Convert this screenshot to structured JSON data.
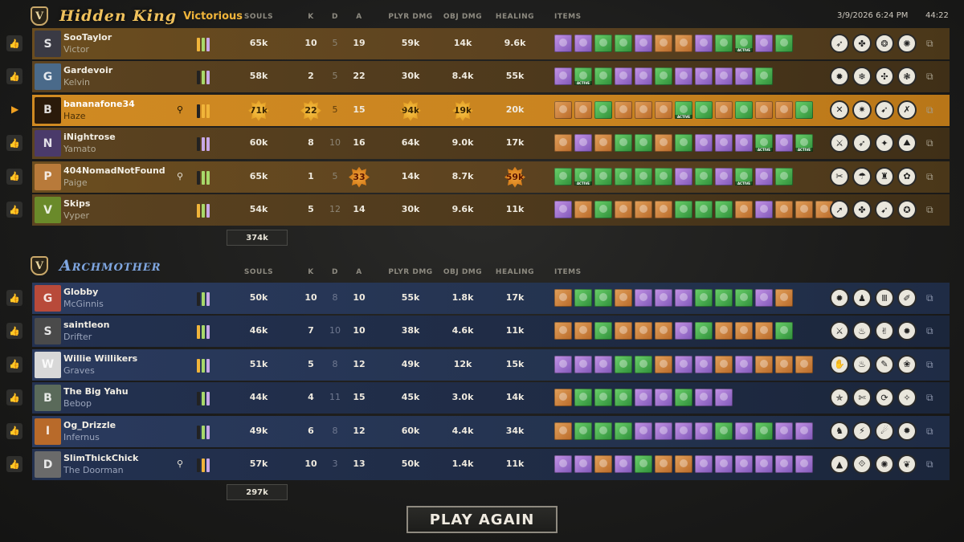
{
  "meta": {
    "datetime": "3/9/2026 6:24 PM",
    "duration": "44:22"
  },
  "headers": {
    "souls": "SOULS",
    "k": "K",
    "d": "D",
    "a": "A",
    "player_damage": "PLYR DMG",
    "objective_damage": "OBJ DMG",
    "healing": "HEALING",
    "items": "ITEMS"
  },
  "team1": {
    "badge": "V",
    "name": "Hidden King",
    "result": "Victorious",
    "total_souls": "374k",
    "players": [
      {
        "name": "SooTaylor",
        "hero": "Victor",
        "souls": "65k",
        "k": "10",
        "d": "5",
        "a": "19",
        "player_damage": "59k",
        "objective_damage": "14k",
        "healing": "9.6k",
        "initial": "S",
        "color": "#3a3a44",
        "bars": [
          "y",
          "g",
          "p"
        ],
        "flag": false,
        "highlights": [],
        "items": [
          {
            "c": "p"
          },
          {
            "c": "p"
          },
          {
            "c": "g"
          },
          {
            "c": "g"
          },
          {
            "c": "p"
          },
          {
            "c": "o"
          },
          {
            "c": "o"
          },
          {
            "c": "p"
          },
          {
            "c": "g"
          },
          {
            "c": "g",
            "active": true
          },
          {
            "c": "p"
          },
          {
            "c": "g"
          }
        ],
        "abilities": [
          "➶",
          "✤",
          "❂",
          "✺"
        ]
      },
      {
        "name": "Gardevoir",
        "hero": "Kelvin",
        "souls": "58k",
        "k": "2",
        "d": "5",
        "a": "22",
        "player_damage": "30k",
        "objective_damage": "8.4k",
        "healing": "55k",
        "initial": "G",
        "color": "#4a6a8a",
        "bars": [
          "d",
          "g",
          "p"
        ],
        "flag": false,
        "highlights": [],
        "items": [
          {
            "c": "p"
          },
          {
            "c": "g",
            "active": true
          },
          {
            "c": "g"
          },
          {
            "c": "p"
          },
          {
            "c": "p"
          },
          {
            "c": "g"
          },
          {
            "c": "p"
          },
          {
            "c": "p"
          },
          {
            "c": "p"
          },
          {
            "c": "p"
          },
          {
            "c": "g"
          }
        ],
        "abilities": [
          "✹",
          "❄",
          "✣",
          "❃"
        ]
      },
      {
        "name": "bananafone34",
        "hero": "Haze",
        "souls": "71k",
        "k": "22",
        "d": "5",
        "a": "15",
        "player_damage": "94k",
        "objective_damage": "19k",
        "healing": "20k",
        "initial": "B",
        "color": "#2a1a0a",
        "bars": [
          "d",
          "y",
          "y"
        ],
        "flag": true,
        "self": true,
        "highlights": [
          "souls",
          "k",
          "player_damage",
          "objective_damage"
        ],
        "items": [
          {
            "c": "o"
          },
          {
            "c": "o"
          },
          {
            "c": "g"
          },
          {
            "c": "o"
          },
          {
            "c": "o"
          },
          {
            "c": "o"
          },
          {
            "c": "g",
            "active": true
          },
          {
            "c": "g"
          },
          {
            "c": "o"
          },
          {
            "c": "g"
          },
          {
            "c": "o"
          },
          {
            "c": "o"
          },
          {
            "c": "g"
          }
        ],
        "abilities": [
          "✕",
          "✷",
          "➹",
          "✗"
        ]
      },
      {
        "name": "iNightrose",
        "hero": "Yamato",
        "souls": "60k",
        "k": "8",
        "d": "10",
        "a": "16",
        "player_damage": "64k",
        "objective_damage": "9.0k",
        "healing": "17k",
        "initial": "N",
        "color": "#4a3a6a",
        "bars": [
          "d",
          "p",
          "p"
        ],
        "flag": false,
        "highlights": [],
        "items": [
          {
            "c": "o"
          },
          {
            "c": "p"
          },
          {
            "c": "o"
          },
          {
            "c": "g"
          },
          {
            "c": "g"
          },
          {
            "c": "o"
          },
          {
            "c": "g"
          },
          {
            "c": "p"
          },
          {
            "c": "p"
          },
          {
            "c": "p"
          },
          {
            "c": "g",
            "active": true
          },
          {
            "c": "p"
          },
          {
            "c": "g",
            "active": true
          }
        ],
        "abilities": [
          "⚔",
          "➶",
          "✦",
          "⛰"
        ]
      },
      {
        "name": "404NomadNotFound",
        "hero": "Paige",
        "souls": "65k",
        "k": "1",
        "d": "5",
        "a": "33",
        "player_damage": "14k",
        "objective_damage": "8.7k",
        "healing": "59k",
        "initial": "P",
        "color": "#b87a3a",
        "bars": [
          "d",
          "g",
          "g"
        ],
        "flag": true,
        "highlights": [
          "a",
          "healing"
        ],
        "items": [
          {
            "c": "g"
          },
          {
            "c": "g",
            "active": true
          },
          {
            "c": "g"
          },
          {
            "c": "g"
          },
          {
            "c": "g"
          },
          {
            "c": "g"
          },
          {
            "c": "p"
          },
          {
            "c": "g"
          },
          {
            "c": "p"
          },
          {
            "c": "g",
            "active": true
          },
          {
            "c": "p"
          },
          {
            "c": "g"
          }
        ],
        "abilities": [
          "✂",
          "☂",
          "♜",
          "✿"
        ]
      },
      {
        "name": "Skips",
        "hero": "Vyper",
        "souls": "54k",
        "k": "5",
        "d": "12",
        "a": "14",
        "player_damage": "30k",
        "objective_damage": "9.6k",
        "healing": "11k",
        "initial": "V",
        "color": "#6a8a2a",
        "bars": [
          "y",
          "g",
          "p"
        ],
        "flag": false,
        "highlights": [],
        "items": [
          {
            "c": "p"
          },
          {
            "c": "o"
          },
          {
            "c": "g"
          },
          {
            "c": "o"
          },
          {
            "c": "o"
          },
          {
            "c": "o"
          },
          {
            "c": "g"
          },
          {
            "c": "g"
          },
          {
            "c": "g"
          },
          {
            "c": "o"
          },
          {
            "c": "p"
          },
          {
            "c": "o"
          },
          {
            "c": "o"
          },
          {
            "c": "o"
          }
        ],
        "abilities": [
          "➚",
          "✤",
          "➹",
          "✪"
        ]
      }
    ]
  },
  "team2": {
    "badge": "V",
    "name": "Archmother",
    "total_souls": "297k",
    "players": [
      {
        "name": "Globby",
        "hero": "McGinnis",
        "souls": "50k",
        "k": "10",
        "d": "8",
        "a": "10",
        "player_damage": "55k",
        "objective_damage": "1.8k",
        "healing": "17k",
        "initial": "G",
        "color": "#b84a3a",
        "bars": [
          "d",
          "g",
          "p"
        ],
        "flag": false,
        "highlights": [],
        "items": [
          {
            "c": "o"
          },
          {
            "c": "g"
          },
          {
            "c": "g"
          },
          {
            "c": "o"
          },
          {
            "c": "p"
          },
          {
            "c": "p"
          },
          {
            "c": "p"
          },
          {
            "c": "g"
          },
          {
            "c": "g"
          },
          {
            "c": "g"
          },
          {
            "c": "p"
          },
          {
            "c": "o"
          }
        ],
        "abilities": [
          "✹",
          "♟",
          "Ⅲ",
          "✐"
        ]
      },
      {
        "name": "saintleon",
        "hero": "Drifter",
        "souls": "46k",
        "k": "7",
        "d": "10",
        "a": "10",
        "player_damage": "38k",
        "objective_damage": "4.6k",
        "healing": "11k",
        "initial": "S",
        "color": "#4a4a4a",
        "bars": [
          "y",
          "g",
          "p"
        ],
        "flag": false,
        "highlights": [],
        "items": [
          {
            "c": "o"
          },
          {
            "c": "o"
          },
          {
            "c": "g"
          },
          {
            "c": "o"
          },
          {
            "c": "o"
          },
          {
            "c": "o"
          },
          {
            "c": "p"
          },
          {
            "c": "g"
          },
          {
            "c": "o"
          },
          {
            "c": "o"
          },
          {
            "c": "o"
          },
          {
            "c": "g"
          }
        ],
        "abilities": [
          "⚔",
          "♨",
          "✌",
          "✹"
        ]
      },
      {
        "name": "Willie Willikers",
        "hero": "Graves",
        "souls": "51k",
        "k": "5",
        "d": "8",
        "a": "12",
        "player_damage": "49k",
        "objective_damage": "12k",
        "healing": "15k",
        "initial": "W",
        "color": "#d8d8d8",
        "bars": [
          "y",
          "g",
          "p"
        ],
        "flag": false,
        "highlights": [],
        "items": [
          {
            "c": "p"
          },
          {
            "c": "p"
          },
          {
            "c": "p"
          },
          {
            "c": "g"
          },
          {
            "c": "g"
          },
          {
            "c": "o"
          },
          {
            "c": "p"
          },
          {
            "c": "p"
          },
          {
            "c": "o"
          },
          {
            "c": "p"
          },
          {
            "c": "o"
          },
          {
            "c": "o"
          },
          {
            "c": "o"
          }
        ],
        "abilities": [
          "✋",
          "♨",
          "✎",
          "❀"
        ]
      },
      {
        "name": "The Big Yahu",
        "hero": "Bebop",
        "souls": "44k",
        "k": "4",
        "d": "11",
        "a": "15",
        "player_damage": "45k",
        "objective_damage": "3.0k",
        "healing": "14k",
        "initial": "B",
        "color": "#5a6a5a",
        "bars": [
          "d",
          "g",
          "p"
        ],
        "flag": false,
        "highlights": [],
        "items": [
          {
            "c": "o"
          },
          {
            "c": "g"
          },
          {
            "c": "g"
          },
          {
            "c": "g"
          },
          {
            "c": "p"
          },
          {
            "c": "p"
          },
          {
            "c": "g"
          },
          {
            "c": "p"
          },
          {
            "c": "p"
          }
        ],
        "abilities": [
          "✯",
          "✄",
          "⟳",
          "✧"
        ]
      },
      {
        "name": "Og_Drizzle",
        "hero": "Infernus",
        "souls": "49k",
        "k": "6",
        "d": "8",
        "a": "12",
        "player_damage": "60k",
        "objective_damage": "4.4k",
        "healing": "34k",
        "initial": "I",
        "color": "#b86a2a",
        "bars": [
          "d",
          "g",
          "p"
        ],
        "flag": false,
        "highlights": [],
        "items": [
          {
            "c": "o"
          },
          {
            "c": "g"
          },
          {
            "c": "g"
          },
          {
            "c": "g"
          },
          {
            "c": "p"
          },
          {
            "c": "p"
          },
          {
            "c": "p"
          },
          {
            "c": "p"
          },
          {
            "c": "g"
          },
          {
            "c": "p"
          },
          {
            "c": "g"
          },
          {
            "c": "p"
          },
          {
            "c": "p"
          }
        ],
        "abilities": [
          "♞",
          "⚡",
          "☄",
          "✹"
        ]
      },
      {
        "name": "SlimThickChick",
        "hero": "The Doorman",
        "souls": "57k",
        "k": "10",
        "d": "3",
        "a": "13",
        "player_damage": "50k",
        "objective_damage": "1.4k",
        "healing": "11k",
        "initial": "D",
        "color": "#6a6a6a",
        "bars": [
          "d",
          "y",
          "p"
        ],
        "flag": true,
        "highlights": [],
        "items": [
          {
            "c": "p"
          },
          {
            "c": "p"
          },
          {
            "c": "o"
          },
          {
            "c": "p"
          },
          {
            "c": "g"
          },
          {
            "c": "o"
          },
          {
            "c": "o"
          },
          {
            "c": "p"
          },
          {
            "c": "p"
          },
          {
            "c": "p"
          },
          {
            "c": "p"
          },
          {
            "c": "p"
          },
          {
            "c": "p"
          }
        ],
        "abilities": [
          "▲",
          "⟐",
          "✺",
          "❦"
        ]
      }
    ]
  },
  "play_again": "PLAY AGAIN"
}
